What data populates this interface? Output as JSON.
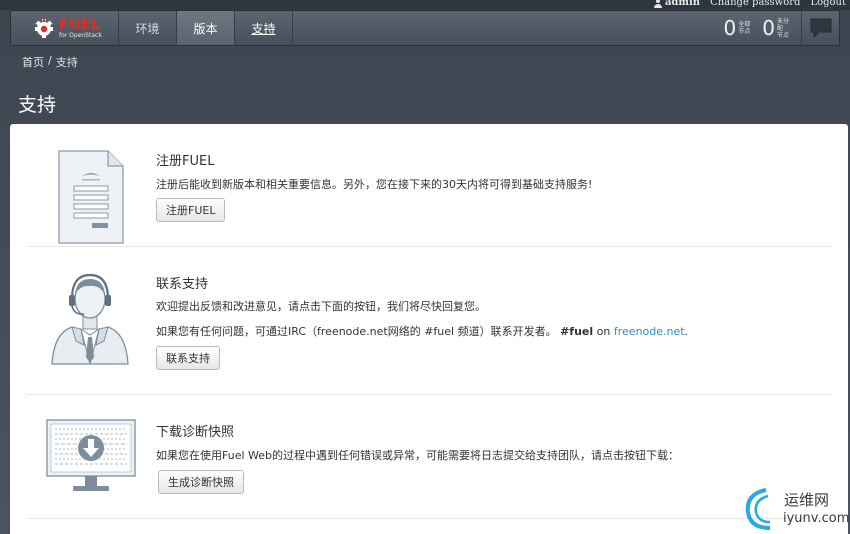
{
  "userbar": {
    "username": "admin",
    "change_password": "Change password",
    "logout": "Logout"
  },
  "navbar": {
    "brand": {
      "title": "FUEL",
      "subtitle": "for OpenStack"
    },
    "tabs": [
      {
        "label": "环境",
        "active": false
      },
      {
        "label": "版本",
        "active": true
      },
      {
        "label": "支持",
        "active": false,
        "current": true
      }
    ],
    "stats": [
      {
        "count": "0",
        "label_line1": "全部",
        "label_line2": "节点"
      },
      {
        "count": "0",
        "label_line1": "未分配",
        "label_line2": "节点"
      }
    ],
    "notification_icon": "chat-bubble-icon"
  },
  "breadcrumb": {
    "home": "首页",
    "separator": "/",
    "current": "支持"
  },
  "page_title": "支持",
  "sections": {
    "register": {
      "title": "注册FUEL",
      "text": "注册后能收到新版本和相关重要信息。另外，您在接下来的30天内将可得到基础支持服务!",
      "button": "注册FUEL",
      "icon": "registration-form-icon"
    },
    "contact": {
      "title": "联系支持",
      "text1": "欢迎提出反馈和改进意见，请点击下面的按钮，我们将尽快回复您。",
      "text2_prefix": "如果您有任何问题，可通过IRC（freenode.net网络的 #fuel 频道）联系开发者。",
      "text2_bold": "#fuel",
      "text2_on": " on ",
      "text2_link": "freenode.net",
      "text2_end": ".",
      "button": "联系支持",
      "icon": "support-agent-icon"
    },
    "snapshot": {
      "title": "下载诊断快照",
      "text": "如果您在使用Fuel Web的过程中遇到任何错误或异常，可能需要将日志提交给支持团队，请点击按钮下载：",
      "button": "生成诊断快照",
      "icon": "monitor-download-icon"
    }
  },
  "watermark": {
    "line1": "运维网",
    "line2": "iyunv.com"
  },
  "colors": {
    "brand_red": "#d9302c",
    "link_blue": "#2a8fbd",
    "nav_bg": "#505b66"
  }
}
